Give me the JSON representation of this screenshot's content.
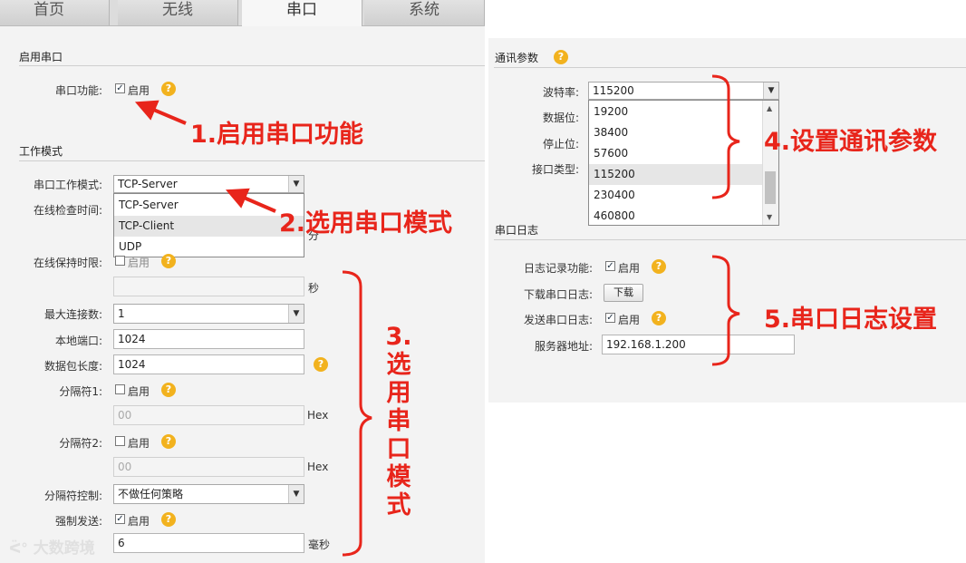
{
  "tabs": [
    {
      "label": "首页"
    },
    {
      "label": "无线"
    },
    {
      "label": "串口",
      "active": true
    },
    {
      "label": "系统"
    }
  ],
  "serial_enable": {
    "section_title": "启用串口",
    "label": "串口功能:",
    "checkbox_text": "启用",
    "checked": true
  },
  "work_mode": {
    "section_title": "工作模式",
    "mode_label": "串口工作模式:",
    "mode_value": "TCP-Server",
    "mode_options": [
      "TCP-Server",
      "TCP-Client",
      "UDP"
    ],
    "highlighted_option": "TCP-Client",
    "online_check_label": "在线检查时间:",
    "online_check_unit": "分",
    "keepalive_label": "在线保持时限:",
    "keepalive_checkbox_text": "启用",
    "keepalive_unit": "秒",
    "max_conn_label": "最大连接数:",
    "max_conn_value": "1",
    "local_port_label": "本地端口:",
    "local_port_value": "1024",
    "packet_len_label": "数据包长度:",
    "packet_len_value": "1024",
    "sep1_label": "分隔符1:",
    "sep1_checkbox_text": "启用",
    "sep1_value": "00",
    "sep1_unit": "Hex",
    "sep2_label": "分隔符2:",
    "sep2_checkbox_text": "启用",
    "sep2_value": "00",
    "sep2_unit": "Hex",
    "sep_ctrl_label": "分隔符控制:",
    "sep_ctrl_value": "不做任何策略",
    "force_send_label": "强制发送:",
    "force_send_checkbox_text": "启用",
    "force_send_checked": true,
    "force_send_value": "6",
    "force_send_unit": "毫秒"
  },
  "comm": {
    "section_title": "通讯参数",
    "baud_label": "波特率:",
    "baud_value": "115200",
    "baud_options": [
      "19200",
      "38400",
      "57600",
      "115200",
      "230400",
      "460800"
    ],
    "baud_highlighted": "115200",
    "data_bits_label": "数据位:",
    "stop_bits_label": "停止位:",
    "iface_label": "接口类型:"
  },
  "log": {
    "section_title": "串口日志",
    "record_label": "日志记录功能:",
    "record_checkbox_text": "启用",
    "download_label": "下载串口日志:",
    "download_button": "下载",
    "send_label": "发送串口日志:",
    "send_checkbox_text": "启用",
    "server_label": "服务器地址:",
    "server_value": "192.168.1.200"
  },
  "annotations": {
    "a1": "1.启用串口功能",
    "a2": "2.选用串口模式",
    "a3": [
      "3.",
      "选",
      "用",
      "串",
      "口",
      "模",
      "式"
    ],
    "a4": "4.设置通讯参数",
    "a5": "5.串口日志设置"
  },
  "watermark": "大数跨境",
  "colors": {
    "annotation": "#e8251b",
    "help_icon": "#f2b21e"
  }
}
